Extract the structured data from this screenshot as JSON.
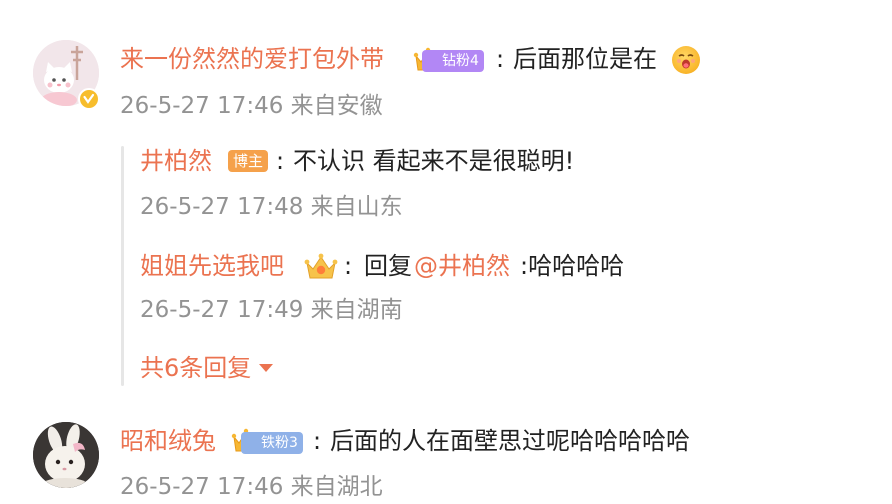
{
  "colors": {
    "username": "#eb7350",
    "text": "#222222",
    "meta": "#939393",
    "badge_diamond": "#b287f5",
    "badge_iron": "#8fb1e8",
    "badge_author": "#f5a14b",
    "verified": "#f7bd2c"
  },
  "comments": [
    {
      "avatar_icon": "cat-avatar-icon",
      "username": "来一份然然的爱打包外带",
      "badge": "钻粉4",
      "separator": ":",
      "content": "后面那位是在",
      "emoji_icon": "smirk-face-emoji-icon",
      "meta": "26-5-27 17:46 来自安徽"
    },
    {
      "avatar_icon": "rabbit-avatar-icon",
      "username": "昭和绒兔",
      "badge": "铁粉3",
      "separator": ":",
      "content": "后面的人在面壁思过呢哈哈哈哈哈",
      "meta": "26-5-27 17:46 来自湖北"
    }
  ],
  "replies": [
    {
      "username": "井柏然",
      "badge": "博主",
      "separator": ":",
      "content": "不认识 看起来不是很聪明!",
      "meta": "26-5-27 17:48 来自山东"
    },
    {
      "username": "姐姐先选我吧",
      "separator": ":",
      "content_prefix": "回复",
      "mention": "@井柏然",
      "content_suffix": ":哈哈哈哈",
      "meta": "26-5-27 17:49 来自湖南"
    }
  ],
  "more_replies": {
    "label": "共6条回复",
    "icon": "caret-down-icon"
  }
}
